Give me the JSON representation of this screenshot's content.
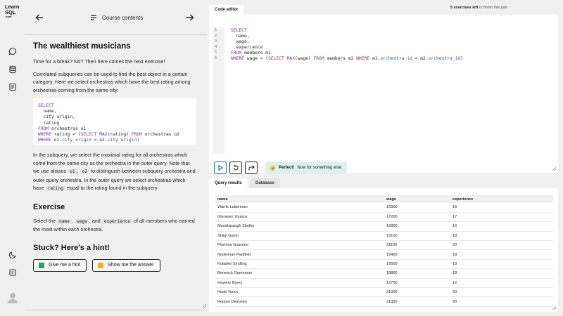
{
  "app": {
    "logo_line1": "Learn",
    "logo_line2": "SQL",
    "logo_line3": "·com"
  },
  "course": {
    "contents_label": "Course contents",
    "title": "The wealthiest musicians",
    "p1": "Time for a break? No? Then here comes the next exercise!",
    "p2": "Correlated subqueries can be used to find the best object in a certain category. Here we select orchestras which have the best rating among orchestras coming from the same city:",
    "p3_a": "In the subquery, we select the maximal rating for all orchestras which come from the same city as the orchestra in the outer query. Note that we use aliases ",
    "alias1": "o1",
    "p3_b": ", ",
    "alias2": "o2",
    "p3_c": " to distinguish between subquery orchestra and outer query orchestra. In the outer query we select orchestras which have ",
    "rating_code": "rating",
    "p3_d": " equal to the rating found in the subquery.",
    "exercise_heading": "Exercise",
    "ex_a": "Select the ",
    "ex_name": "name",
    "ex_b": ", ",
    "ex_wage": "wage",
    "ex_c": ", and ",
    "ex_experience": "experience",
    "ex_d": " of all members who earned the most within each orchestra.",
    "hint_heading": "Stuck? Here's a hint!",
    "hint_button": "Give me a hint",
    "answer_button": "Show me the answer"
  },
  "workspace": {
    "progress_bold": "5 exercises left",
    "progress_rest": " to finish this part",
    "editor_tab": "Code editor",
    "line_numbers": "1\n2\n3\n4\n5\n6",
    "feedback_bold": "Perfect!",
    "feedback_rest": " Now for something else.",
    "results_tab": "Query results",
    "database_tab": "Database"
  },
  "results": {
    "headers": [
      "name",
      "wage",
      "experience"
    ],
    "rows": [
      [
        "Warrik Lutterman",
        "16900",
        "16"
      ],
      [
        "Glenister Younce",
        "17200",
        "17"
      ],
      [
        "Moodispaugh Shelko",
        "16900",
        "16"
      ],
      [
        "Shiigi Gayer",
        "19100",
        "18"
      ],
      [
        "Plomma Guareno",
        "21100",
        "20"
      ],
      [
        "Nodelman Padfield",
        "19400",
        "18"
      ],
      [
        "Kolapke Sindling",
        "19500",
        "19"
      ],
      [
        "Benesch Gammons",
        "18800",
        "18"
      ],
      [
        "Hayertz Byers",
        "12700",
        "12"
      ],
      [
        "Haak Yancy",
        "21000",
        "20"
      ],
      [
        "Hoppin Demateo",
        "21300",
        "20"
      ]
    ]
  },
  "colors": {
    "run_accent": "#1565c0",
    "success_bg": "#dcf1ec",
    "keyword": "#7a2aa0",
    "column": "#2a4bbf",
    "hint_icon": "#2f9e6e",
    "answer_icon": "#e9b520"
  }
}
